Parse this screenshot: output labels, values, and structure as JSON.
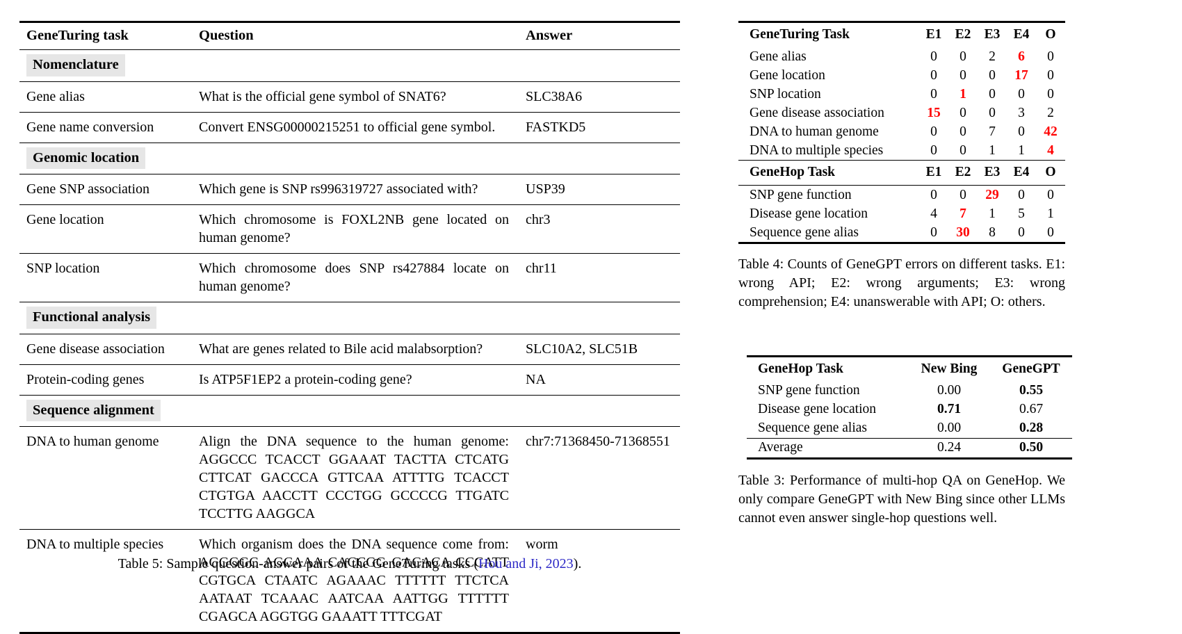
{
  "table5": {
    "headers": [
      "GeneTuring task",
      "Question",
      "Answer"
    ],
    "sections": [
      {
        "label": "Nomenclature",
        "rows": [
          {
            "task": "Gene alias",
            "question": "What is the official gene symbol of SNAT6?",
            "answer": "SLC38A6"
          },
          {
            "task": "Gene name conversion",
            "question": "Convert ENSG00000215251 to official gene symbol.",
            "answer": "FASTKD5"
          }
        ]
      },
      {
        "label": "Genomic location",
        "rows": [
          {
            "task": "Gene SNP association",
            "question": "Which gene is SNP rs996319727 associated with?",
            "answer": "USP39"
          },
          {
            "task": "Gene location",
            "question": "Which chromosome is FOXL2NB gene located on human genome?",
            "answer": "chr3"
          },
          {
            "task": "SNP location",
            "question": "Which chromosome does SNP rs427884 locate on human genome?",
            "answer": "chr11"
          }
        ]
      },
      {
        "label": "Functional analysis",
        "rows": [
          {
            "task": "Gene disease association",
            "question": "What are genes related to Bile acid malabsorption?",
            "answer": "SLC10A2, SLC51B"
          },
          {
            "task": "Protein-coding genes",
            "question": "Is ATP5F1EP2 a protein-coding gene?",
            "answer": "NA"
          }
        ]
      },
      {
        "label": "Sequence alignment",
        "rows": [
          {
            "task": "DNA to human genome",
            "question": "Align the DNA sequence to the human genome: AGGCCC TCACCT GGAAAT TACTTA CTCATG CTTCAT GACCCA GTTCAA ATTTTG TCACCT CTGTGA AACCTT CCCTGG GCCCCG TTGATC TCCTTG AAGGCA",
            "answer": "chr7:71368450-71368551"
          },
          {
            "task": "DNA to multiple species",
            "question": "Which organism does the DNA sequence come from: AGGGGC AGCAAA CACCGG GACACA CCCATT CGTGCA CTAATC AGAAAC TTTTTT TTCTCA AATAAT TCAAAC AATCAA AATTGG TTTTTT CGAGCA AGGTGG GAAATT TTTCGAT",
            "answer": "worm"
          }
        ]
      }
    ],
    "caption_prefix": "Table 5: Sample question-answer pairs of the GeneTuring tasks (",
    "caption_cite": "Hou and Ji, 2023",
    "caption_suffix": ")."
  },
  "table4": {
    "geneturing": {
      "header": [
        "GeneTuring Task",
        "E1",
        "E2",
        "E3",
        "E4",
        "O"
      ],
      "rows": [
        {
          "task": "Gene alias",
          "e1": "0",
          "e2": "0",
          "e3": "2",
          "e4": "6",
          "o": "0"
        },
        {
          "task": "Gene location",
          "e1": "0",
          "e2": "0",
          "e3": "0",
          "e4": "17",
          "o": "0"
        },
        {
          "task": "SNP location",
          "e1": "0",
          "e2": "1",
          "e3": "0",
          "e4": "0",
          "o": "0"
        },
        {
          "task": "Gene disease association",
          "e1": "15",
          "e2": "0",
          "e3": "0",
          "e4": "3",
          "o": "2"
        },
        {
          "task": "DNA to human genome",
          "e1": "0",
          "e2": "0",
          "e3": "7",
          "e4": "0",
          "o": "42"
        },
        {
          "task": "DNA to multiple species",
          "e1": "0",
          "e2": "0",
          "e3": "1",
          "e4": "1",
          "o": "4"
        }
      ],
      "highlight": [
        {
          "e1": false,
          "e2": false,
          "e3": false,
          "e4": true,
          "o": false
        },
        {
          "e1": false,
          "e2": false,
          "e3": false,
          "e4": true,
          "o": false
        },
        {
          "e1": false,
          "e2": true,
          "e3": false,
          "e4": false,
          "o": false
        },
        {
          "e1": true,
          "e2": false,
          "e3": false,
          "e4": false,
          "o": false
        },
        {
          "e1": false,
          "e2": false,
          "e3": false,
          "e4": false,
          "o": true
        },
        {
          "e1": false,
          "e2": false,
          "e3": false,
          "e4": false,
          "o": true
        }
      ]
    },
    "genehop": {
      "header": [
        "GeneHop Task",
        "E1",
        "E2",
        "E3",
        "E4",
        "O"
      ],
      "rows": [
        {
          "task": "SNP gene function",
          "e1": "0",
          "e2": "0",
          "e3": "29",
          "e4": "0",
          "o": "0"
        },
        {
          "task": "Disease gene location",
          "e1": "4",
          "e2": "7",
          "e3": "1",
          "e4": "5",
          "o": "1"
        },
        {
          "task": "Sequence gene alias",
          "e1": "0",
          "e2": "30",
          "e3": "8",
          "e4": "0",
          "o": "0"
        }
      ],
      "highlight": [
        {
          "e1": false,
          "e2": false,
          "e3": true,
          "e4": false,
          "o": false
        },
        {
          "e1": false,
          "e2": true,
          "e3": false,
          "e4": false,
          "o": false
        },
        {
          "e1": false,
          "e2": true,
          "e3": false,
          "e4": false,
          "o": false
        }
      ]
    },
    "caption": "Table 4: Counts of GeneGPT errors on different tasks. E1: wrong API; E2: wrong arguments; E3: wrong comprehension; E4: unanswerable with API; O: others."
  },
  "table3": {
    "header": [
      "GeneHop Task",
      "New Bing",
      "GeneGPT"
    ],
    "rows": [
      {
        "task": "SNP gene function",
        "new_bing": "0.00",
        "genegpt": "0.55",
        "bing_bold": false,
        "gpt_bold": true
      },
      {
        "task": "Disease gene location",
        "new_bing": "0.71",
        "genegpt": "0.67",
        "bing_bold": true,
        "gpt_bold": false
      },
      {
        "task": "Sequence gene alias",
        "new_bing": "0.00",
        "genegpt": "0.28",
        "bing_bold": false,
        "gpt_bold": true
      }
    ],
    "average": {
      "task": "Average",
      "new_bing": "0.24",
      "genegpt": "0.50",
      "bing_bold": false,
      "gpt_bold": true
    },
    "caption": "Table 3: Performance of multi-hop QA on GeneHop. We only compare GeneGPT with New Bing since other LLMs cannot even answer single-hop questions well."
  }
}
